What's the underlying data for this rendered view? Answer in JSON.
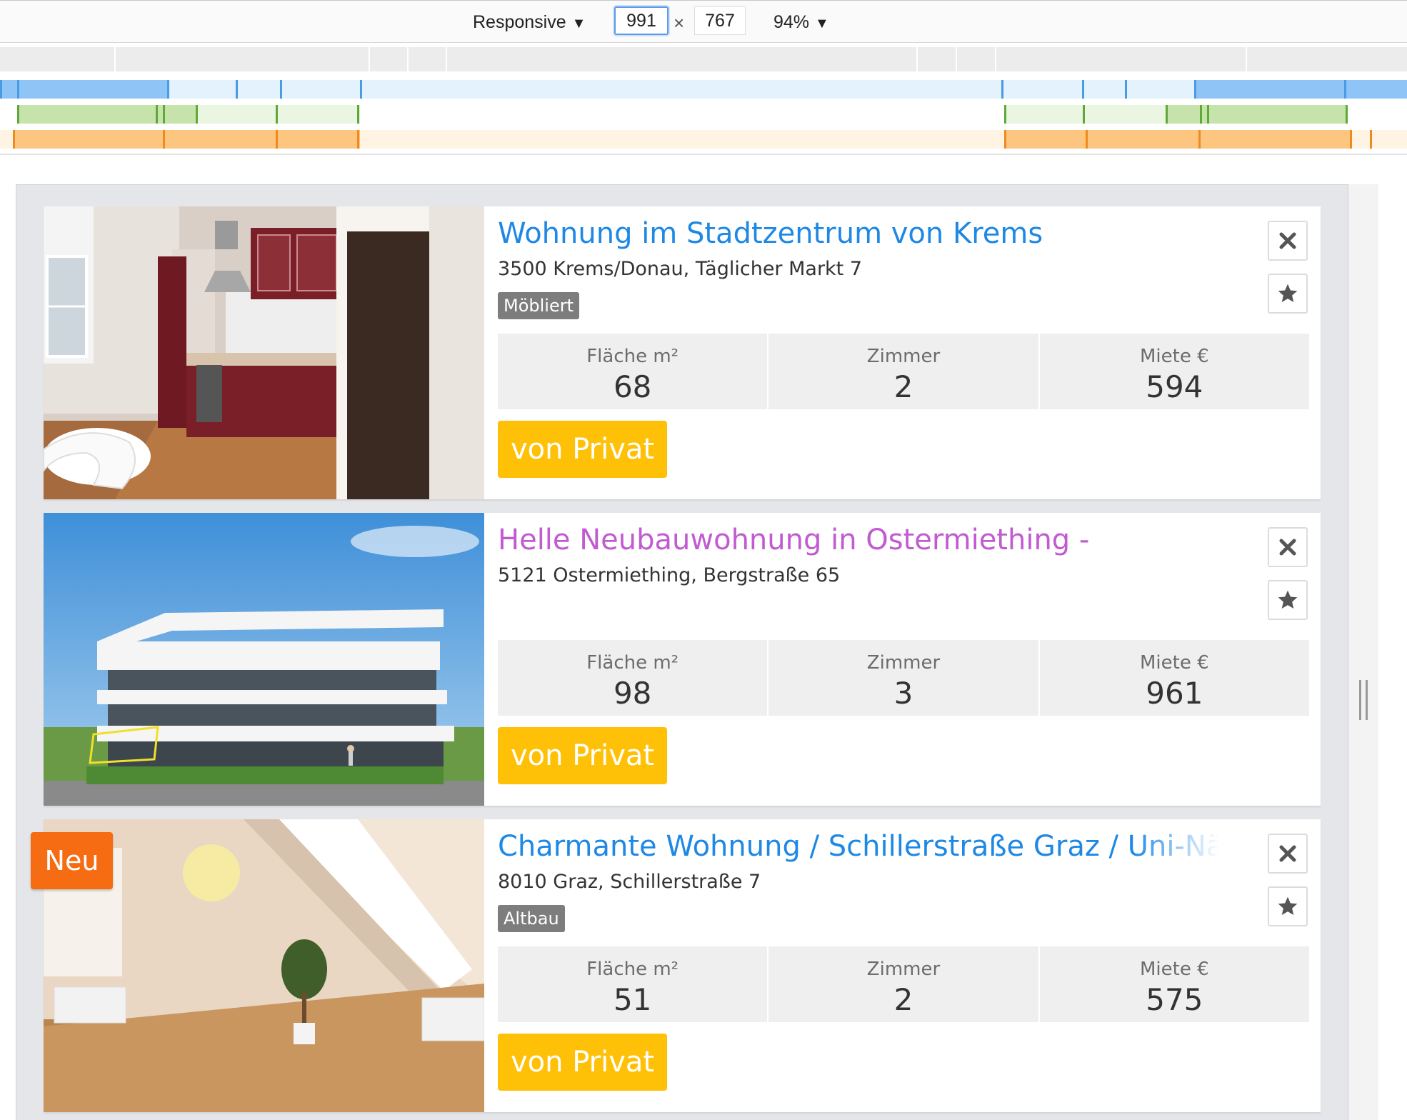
{
  "devtools": {
    "device_mode": "Responsive",
    "width": "991",
    "times": "×",
    "height": "767",
    "zoom": "94%",
    "dropdown_glyph": "▼"
  },
  "colors": {
    "link": "#1e88e5",
    "visited_link": "#c25bd1",
    "private_badge": "#ffc107",
    "new_badge": "#f66c12",
    "tag": "#7d7d7d",
    "mq_blue": "#8ec5f6",
    "mq_green": "#c7e3ac",
    "mq_orange": "#fcc681"
  },
  "listings": [
    {
      "title": "Wohnung im Stadtzentrum von Krems",
      "visited": false,
      "address": "3500 Krems/Donau, Täglicher Markt 7",
      "tag": "Möbliert",
      "stats": [
        {
          "label": "Fläche m²",
          "value": "68"
        },
        {
          "label": "Zimmer",
          "value": "2"
        },
        {
          "label": "Miete €",
          "value": "594"
        }
      ],
      "badge": "von Privat",
      "image": "kitchen-photo"
    },
    {
      "title": "Helle Neubauwohnung in Ostermiething -",
      "visited": true,
      "address": "5121 Ostermiething, Bergstraße 65",
      "tag": "",
      "stats": [
        {
          "label": "Fläche m²",
          "value": "98"
        },
        {
          "label": "Zimmer",
          "value": "3"
        },
        {
          "label": "Miete €",
          "value": "961"
        }
      ],
      "badge": "von Privat",
      "image": "building-photo"
    },
    {
      "title": "Charmante Wohnung / Schillerstraße Graz / Uni-Näh",
      "visited": false,
      "address": "8010 Graz, Schillerstraße 7",
      "tag": "Altbau",
      "stats": [
        {
          "label": "Fläche m²",
          "value": "51"
        },
        {
          "label": "Zimmer",
          "value": "2"
        },
        {
          "label": "Miete €",
          "value": "575"
        }
      ],
      "badge": "von Privat",
      "image": "attic-room-photo",
      "new_label": "Neu"
    }
  ],
  "icons": {
    "close": "close-icon",
    "favorite": "star-icon"
  }
}
